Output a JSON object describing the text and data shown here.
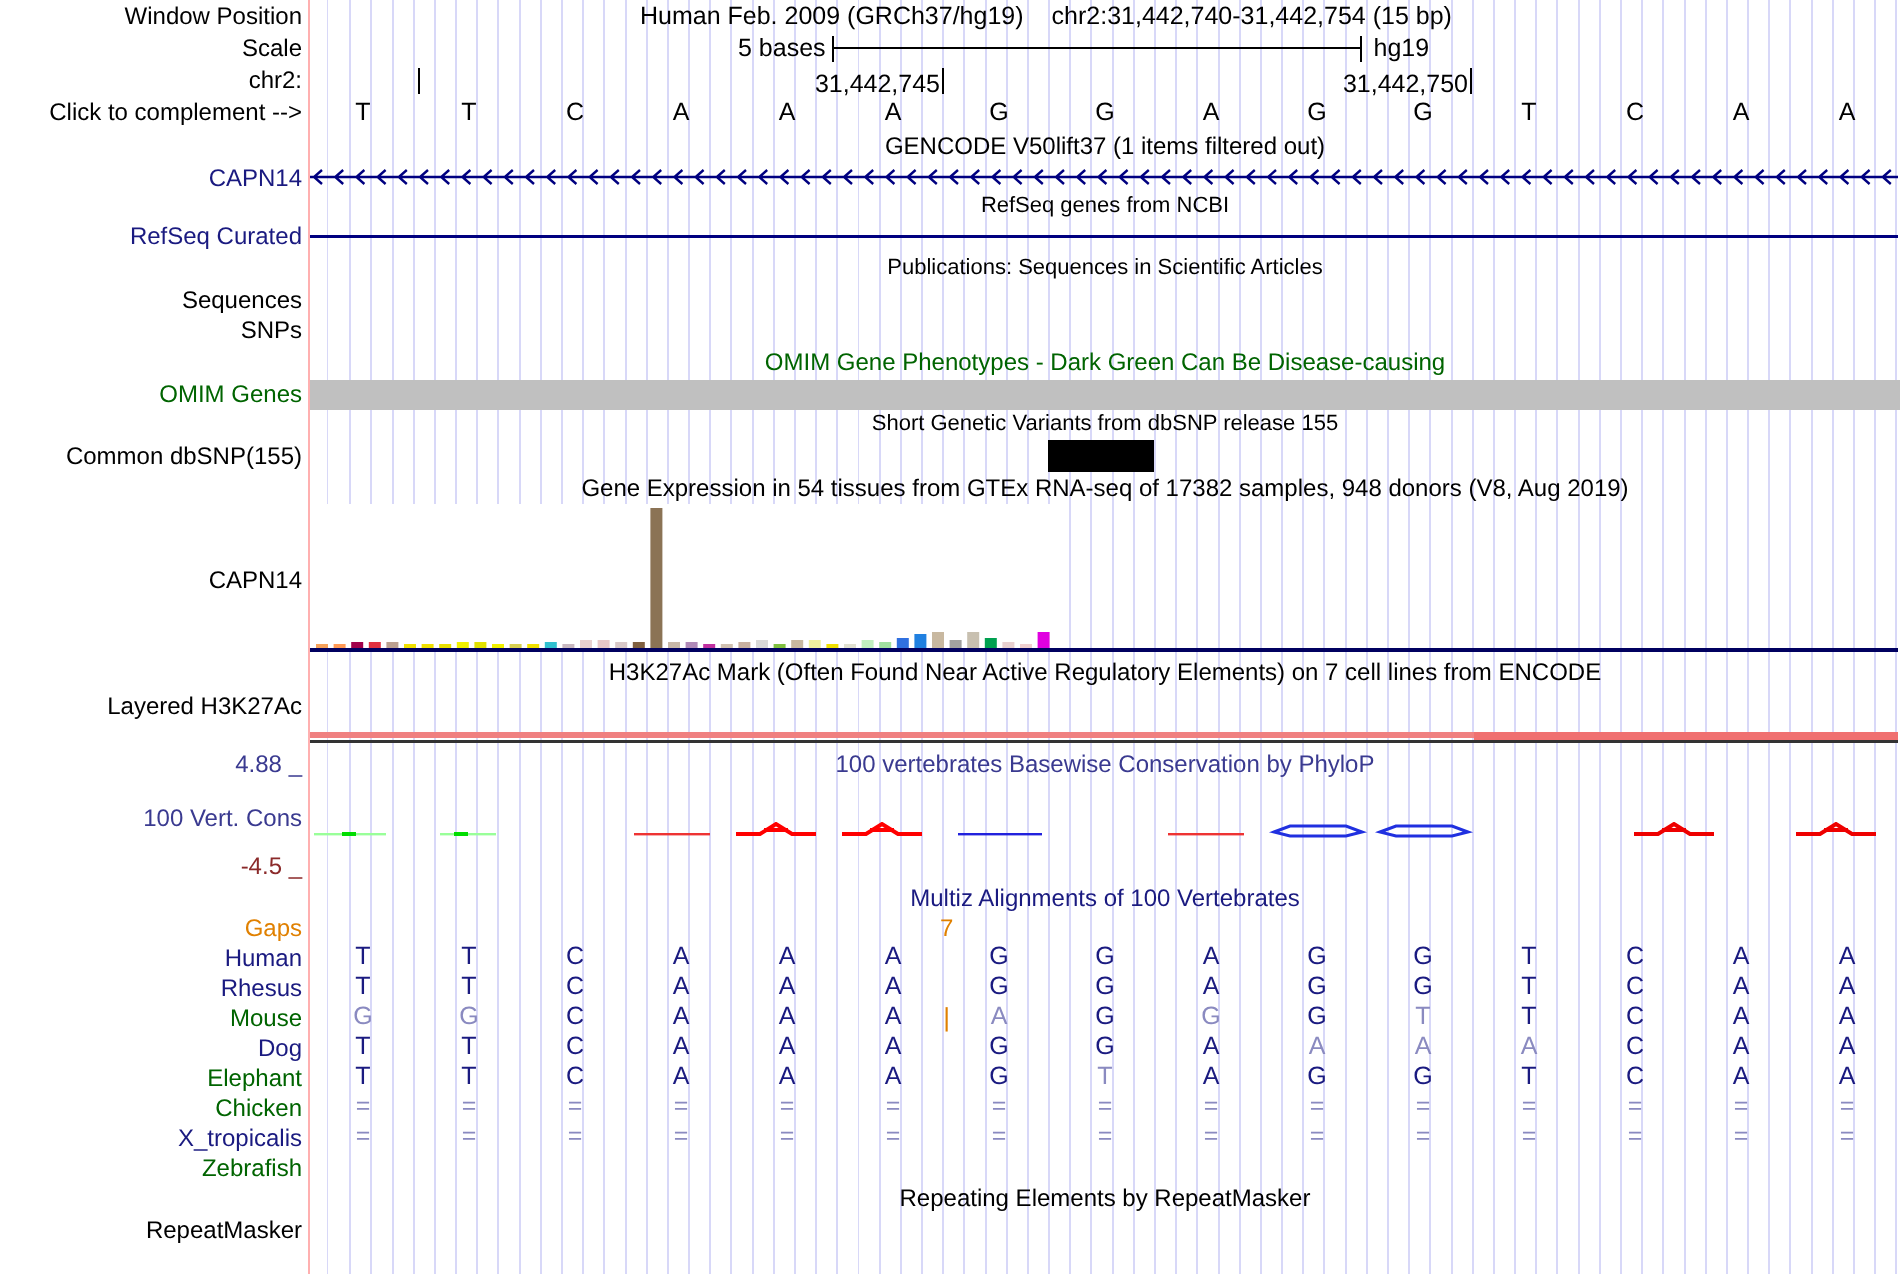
{
  "ruler": {
    "window_position_label": "Window Position",
    "assembly": "Human Feb. 2009 (GRCh37/hg19)",
    "position": "chr2:31,442,740-31,442,754 (15 bp)",
    "scale_label": "Scale",
    "scale_text": "5 bases",
    "scale_assembly": "hg19",
    "chrom_label": "chr2:",
    "ticks": [
      {
        "label": "31,442,745"
      },
      {
        "label": "31,442,750"
      }
    ],
    "complement_label": "Click to complement -->"
  },
  "bases": [
    "T",
    "T",
    "C",
    "A",
    "A",
    "A",
    "G",
    "G",
    "A",
    "G",
    "G",
    "T",
    "C",
    "A",
    "A"
  ],
  "gencode": {
    "title": "GENCODE V50lift37 (1 items filtered out)",
    "label": "CAPN14"
  },
  "refseq": {
    "title": "RefSeq genes from NCBI",
    "label": "RefSeq Curated"
  },
  "publications": {
    "title": "Publications: Sequences in Scientific Articles",
    "label": "Sequences"
  },
  "snps": {
    "label": "SNPs"
  },
  "omim": {
    "title": "OMIM Gene Phenotypes - Dark Green Can Be Disease-causing",
    "label": "OMIM Genes"
  },
  "dbsnp": {
    "title": "Short Genetic Variants from dbSNP release 155",
    "label": "Common dbSNP(155)"
  },
  "gtex": {
    "title": "Gene Expression in 54 tissues from GTEx RNA-seq of 17382 samples, 948 donors (V8, Aug 2019)",
    "label": "CAPN14"
  },
  "h3k27ac": {
    "title": "H3K27Ac Mark (Often Found Near Active Regulatory Elements) on 7 cell lines from ENCODE",
    "label": "Layered H3K27Ac"
  },
  "phylop": {
    "title": "100 vertebrates Basewise Conservation by PhyloP",
    "label": "100 Vert. Cons",
    "max": "4.88 _",
    "min": "-4.5 _"
  },
  "multiz": {
    "title": "Multiz Alignments of 100 Vertebrates",
    "gaps_label": "Gaps",
    "gaps_count": "7",
    "species": [
      {
        "name": "Human",
        "color": "#1a1a80",
        "bases": [
          {
            "base": "T",
            "faded": false
          },
          {
            "base": "T",
            "faded": false
          },
          {
            "base": "C",
            "faded": false
          },
          {
            "base": "A",
            "faded": false
          },
          {
            "base": "A",
            "faded": false
          },
          {
            "base": "A",
            "faded": false
          },
          {
            "base": "G",
            "faded": false
          },
          {
            "base": "G",
            "faded": false
          },
          {
            "base": "A",
            "faded": false
          },
          {
            "base": "G",
            "faded": false
          },
          {
            "base": "G",
            "faded": false
          },
          {
            "base": "T",
            "faded": false
          },
          {
            "base": "C",
            "faded": false
          },
          {
            "base": "A",
            "faded": false
          },
          {
            "base": "A",
            "faded": false
          }
        ]
      },
      {
        "name": "Rhesus",
        "color": "#1a1a80",
        "bases": [
          {
            "base": "T",
            "faded": false
          },
          {
            "base": "T",
            "faded": false
          },
          {
            "base": "C",
            "faded": false
          },
          {
            "base": "A",
            "faded": false
          },
          {
            "base": "A",
            "faded": false
          },
          {
            "base": "A",
            "faded": false
          },
          {
            "base": "G",
            "faded": false
          },
          {
            "base": "G",
            "faded": false
          },
          {
            "base": "A",
            "faded": false
          },
          {
            "base": "G",
            "faded": false
          },
          {
            "base": "G",
            "faded": false
          },
          {
            "base": "T",
            "faded": false
          },
          {
            "base": "C",
            "faded": false
          },
          {
            "base": "A",
            "faded": false
          },
          {
            "base": "A",
            "faded": false
          }
        ]
      },
      {
        "name": "Mouse",
        "color": "#006400",
        "bases": [
          {
            "base": "G",
            "faded": true
          },
          {
            "base": "G",
            "faded": true
          },
          {
            "base": "C",
            "faded": false
          },
          {
            "base": "A",
            "faded": false
          },
          {
            "base": "A",
            "faded": false
          },
          {
            "base": "A",
            "faded": false,
            "insertion_mark": "|"
          },
          {
            "base": "A",
            "faded": true
          },
          {
            "base": "G",
            "faded": false
          },
          {
            "base": "G",
            "faded": true
          },
          {
            "base": "G",
            "faded": false
          },
          {
            "base": "T",
            "faded": true
          },
          {
            "base": "T",
            "faded": false
          },
          {
            "base": "C",
            "faded": false
          },
          {
            "base": "A",
            "faded": false
          },
          {
            "base": "A",
            "faded": false
          }
        ]
      },
      {
        "name": "Dog",
        "color": "#1a1a80",
        "bases": [
          {
            "base": "T",
            "faded": false
          },
          {
            "base": "T",
            "faded": false
          },
          {
            "base": "C",
            "faded": false
          },
          {
            "base": "A",
            "faded": false
          },
          {
            "base": "A",
            "faded": false
          },
          {
            "base": "A",
            "faded": false
          },
          {
            "base": "G",
            "faded": false
          },
          {
            "base": "G",
            "faded": false
          },
          {
            "base": "A",
            "faded": false
          },
          {
            "base": "A",
            "faded": true
          },
          {
            "base": "A",
            "faded": true
          },
          {
            "base": "A",
            "faded": true
          },
          {
            "base": "C",
            "faded": false
          },
          {
            "base": "A",
            "faded": false
          },
          {
            "base": "A",
            "faded": false
          }
        ]
      },
      {
        "name": "Elephant",
        "color": "#006400",
        "bases": [
          {
            "base": "T",
            "faded": false
          },
          {
            "base": "T",
            "faded": false
          },
          {
            "base": "C",
            "faded": false
          },
          {
            "base": "A",
            "faded": false
          },
          {
            "base": "A",
            "faded": false
          },
          {
            "base": "A",
            "faded": false
          },
          {
            "base": "G",
            "faded": false
          },
          {
            "base": "T",
            "faded": true
          },
          {
            "base": "A",
            "faded": false
          },
          {
            "base": "G",
            "faded": false
          },
          {
            "base": "G",
            "faded": false
          },
          {
            "base": "T",
            "faded": false
          },
          {
            "base": "C",
            "faded": false
          },
          {
            "base": "A",
            "faded": false
          },
          {
            "base": "A",
            "faded": false
          }
        ]
      },
      {
        "name": "Chicken",
        "color": "#006400",
        "bases": [
          {
            "base": "=",
            "faded": true
          },
          {
            "base": "=",
            "faded": true
          },
          {
            "base": "=",
            "faded": true
          },
          {
            "base": "=",
            "faded": true
          },
          {
            "base": "=",
            "faded": true
          },
          {
            "base": "=",
            "faded": true
          },
          {
            "base": "=",
            "faded": true
          },
          {
            "base": "=",
            "faded": true
          },
          {
            "base": "=",
            "faded": true
          },
          {
            "base": "=",
            "faded": true
          },
          {
            "base": "=",
            "faded": true
          },
          {
            "base": "=",
            "faded": true
          },
          {
            "base": "=",
            "faded": true
          },
          {
            "base": "=",
            "faded": true
          },
          {
            "base": "=",
            "faded": true
          }
        ]
      },
      {
        "name": "X_tropicalis",
        "color": "#1a1a80",
        "bases": [
          {
            "base": "=",
            "faded": true
          },
          {
            "base": "=",
            "faded": true
          },
          {
            "base": "=",
            "faded": true
          },
          {
            "base": "=",
            "faded": true
          },
          {
            "base": "=",
            "faded": true
          },
          {
            "base": "=",
            "faded": true
          },
          {
            "base": "=",
            "faded": true
          },
          {
            "base": "=",
            "faded": true
          },
          {
            "base": "=",
            "faded": true
          },
          {
            "base": "=",
            "faded": true
          },
          {
            "base": "=",
            "faded": true
          },
          {
            "base": "=",
            "faded": true
          },
          {
            "base": "=",
            "faded": true
          },
          {
            "base": "=",
            "faded": true
          },
          {
            "base": "=",
            "faded": true
          }
        ]
      },
      {
        "name": "Zebrafish",
        "color": "#006400"
      }
    ]
  },
  "repeatmasker": {
    "title": "Repeating Elements by RepeatMasker",
    "label": "RepeatMasker"
  }
}
